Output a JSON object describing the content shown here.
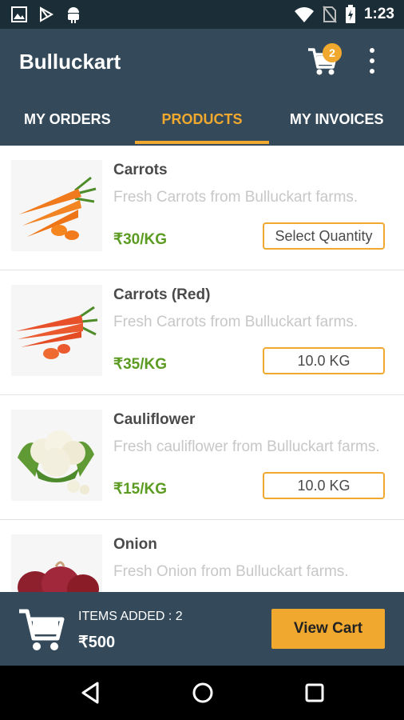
{
  "status_bar": {
    "time": "1:23",
    "icons": [
      "image-icon",
      "play-store-icon",
      "android-icon",
      "wifi-icon",
      "no-sim-icon",
      "battery-charging-icon"
    ]
  },
  "app_bar": {
    "title": "Bulluckart",
    "cart_badge": "2",
    "tabs": [
      {
        "label": "MY ORDERS"
      },
      {
        "label": "PRODUCTS",
        "active": true
      },
      {
        "label": "MY INVOICES"
      }
    ],
    "accent_color": "#f0a92e",
    "background_color": "#34495a"
  },
  "products": [
    {
      "name": "Carrots",
      "description": "Fresh Carrots from Bulluckart farms.",
      "price": "₹30/KG",
      "quantity": "Select Quantity",
      "image": "carrots-image"
    },
    {
      "name": "Carrots (Red)",
      "description": "Fresh Carrots from Bulluckart farms.",
      "price": "₹35/KG",
      "quantity": "10.0 KG",
      "image": "red-carrots-image"
    },
    {
      "name": "Cauliflower",
      "description": "Fresh cauliflower from Bulluckart farms.",
      "price": "₹15/KG",
      "quantity": "10.0 KG",
      "image": "cauliflower-image"
    },
    {
      "name": "Onion",
      "description": "Fresh Onion from Bulluckart farms.",
      "price": "",
      "quantity": "",
      "image": "onion-image"
    }
  ],
  "bottom_bar": {
    "items_added": "ITEMS ADDED : 2",
    "total": "₹500",
    "view_cart_label": "View Cart"
  },
  "nav_bar": {
    "icons": [
      "back-icon",
      "home-icon",
      "recents-icon"
    ]
  },
  "price_color": "#5b9b21"
}
